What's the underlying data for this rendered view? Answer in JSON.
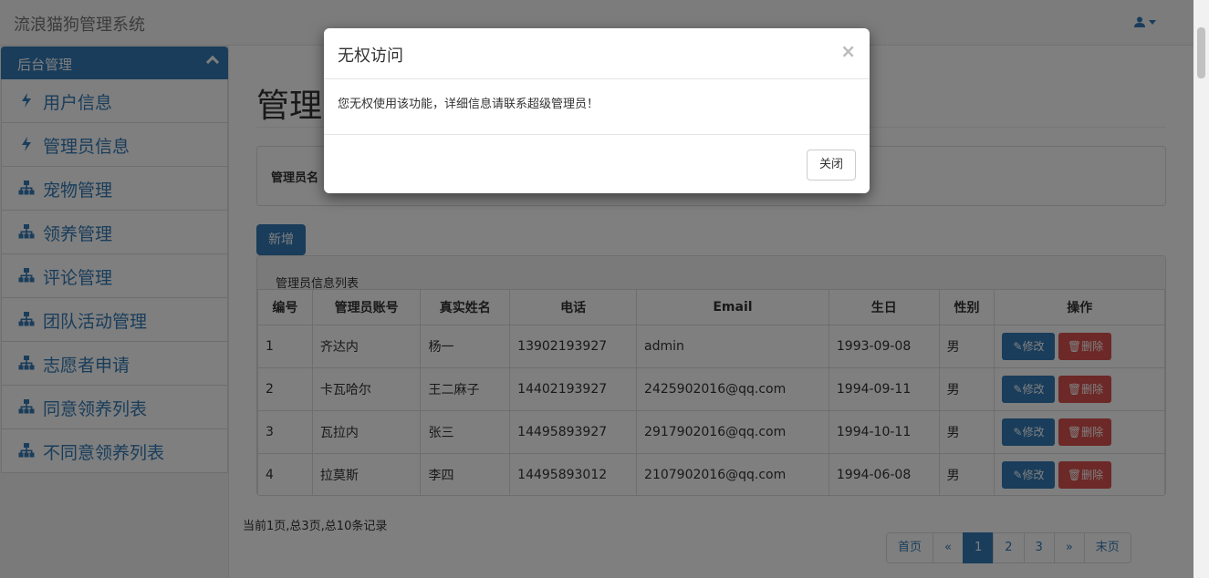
{
  "navbar": {
    "brand": "流浪猫狗管理系统"
  },
  "sidebar": {
    "heading": "后台管理",
    "items": [
      {
        "label": "用户信息",
        "icon": "bolt-icon"
      },
      {
        "label": "管理员信息",
        "icon": "bolt-icon"
      },
      {
        "label": "宠物管理",
        "icon": "sitemap-icon"
      },
      {
        "label": "领养管理",
        "icon": "sitemap-icon"
      },
      {
        "label": "评论管理",
        "icon": "sitemap-icon"
      },
      {
        "label": "团队活动管理",
        "icon": "sitemap-icon"
      },
      {
        "label": "志愿者申请",
        "icon": "sitemap-icon"
      },
      {
        "label": "同意领养列表",
        "icon": "sitemap-icon"
      },
      {
        "label": "不同意领养列表",
        "icon": "sitemap-icon"
      }
    ]
  },
  "main": {
    "page_title": "管理",
    "search_label": "管理员名",
    "add_label": "新增",
    "list_title": "管理员信息列表",
    "columns": [
      "编号",
      "管理员账号",
      "真实姓名",
      "电话",
      "Email",
      "生日",
      "性别",
      "操作"
    ],
    "rows": [
      [
        "1",
        "齐达内",
        "杨一",
        "13902193927",
        "admin",
        "1993-09-08",
        "男"
      ],
      [
        "2",
        "卡瓦哈尔",
        "王二麻子",
        "14402193927",
        "2425902016@qq.com",
        "1994-09-11",
        "男"
      ],
      [
        "3",
        "瓦拉内",
        "张三",
        "14495893927",
        "2917902016@qq.com",
        "1994-10-11",
        "男"
      ],
      [
        "4",
        "拉莫斯",
        "李四",
        "14495893012",
        "2107902016@qq.com",
        "1994-06-08",
        "男"
      ]
    ],
    "edit_label": "✎修改",
    "delete_label": "🗑删除",
    "record_info": "当前1页,总3页,总10条记录",
    "pagination": [
      "首页",
      "«",
      "1",
      "2",
      "3",
      "»",
      "末页"
    ]
  },
  "modal": {
    "title": "无权访问",
    "close_symbol": "×",
    "body": "您无权使用该功能，详细信息请联系超级管理员！",
    "button": "关闭"
  },
  "colors": {
    "primary": "#337ab7",
    "danger": "#d9534f"
  }
}
